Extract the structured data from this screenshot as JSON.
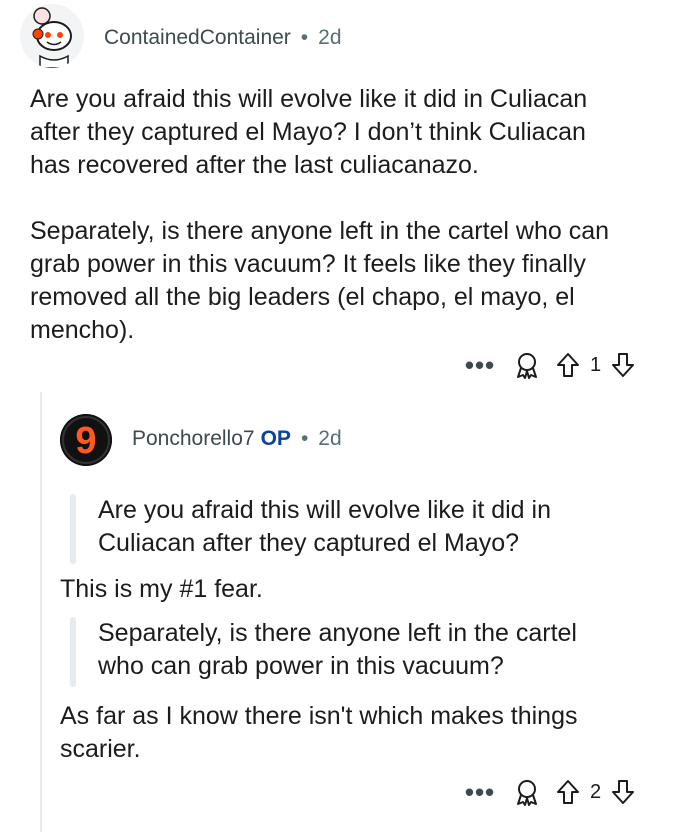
{
  "comment1": {
    "username": "ContainedContainer",
    "separator": "•",
    "age": "2d",
    "paragraphs": [
      [
        "Are you afraid this will evolve like it did in Culiacan",
        "after they captured el Mayo? I don’t think Culiacan",
        "has recovered after the last culiacanazo."
      ],
      [
        "Separately, is there anyone left in the cartel who can",
        "grab power in this vacuum? It feels like they finally",
        "removed all the big leaders (el chapo, el mayo, el",
        "mencho)."
      ]
    ],
    "actions": {
      "more": "•••",
      "award_icon": "award-icon",
      "upvote_icon": "upvote-icon",
      "score": "1",
      "downvote_icon": "downvote-icon"
    }
  },
  "comment2": {
    "username": "Ponchorello7",
    "op_badge": "OP",
    "separator": "•",
    "age": "2d",
    "avatar_glyph": "9",
    "quote1": [
      "Are you afraid this will evolve like it did in",
      "Culiacan after they captured el Mayo?"
    ],
    "reply1": "This is my #1 fear.",
    "quote2": [
      "Separately, is there anyone left in the cartel",
      "who can grab power in this vacuum?"
    ],
    "reply2": [
      "As far as I know there isn't which makes things",
      "scarier."
    ],
    "actions": {
      "more": "•••",
      "award_icon": "award-icon",
      "upvote_icon": "upvote-icon",
      "score": "2",
      "downvote_icon": "downvote-icon"
    }
  },
  "colors": {
    "text": "#1c1c1c",
    "meta": "#576f76",
    "op": "#0a449b",
    "quote_bar": "#e5ebee",
    "thread_line": "#e5ebee"
  }
}
